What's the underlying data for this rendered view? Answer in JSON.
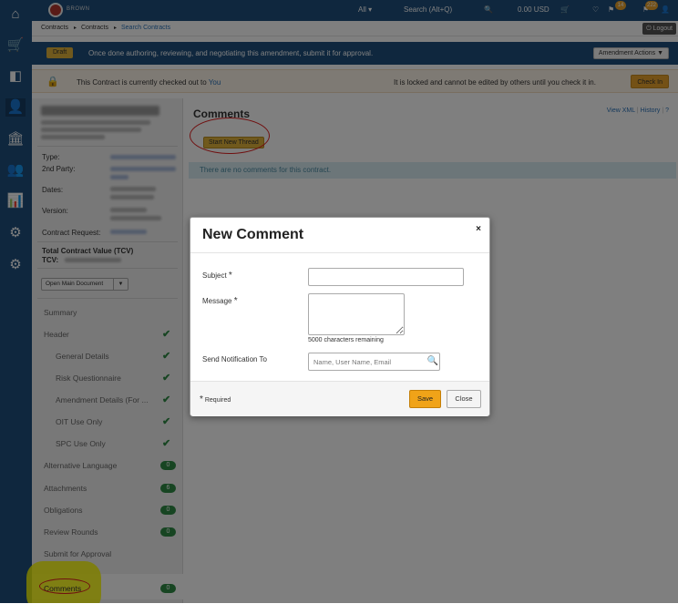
{
  "icons": {
    "home": "⌂",
    "cart": "🛒",
    "contracts": "◧",
    "user": "👤",
    "bank": "🏛",
    "group": "👥",
    "chart": "📊",
    "settings_user": "⚙",
    "gear": "⚙",
    "lock": "🔒",
    "search": "🔍",
    "close": "×",
    "caret": "▼",
    "chevron": "▸"
  },
  "header": {
    "logo_text": "BROWN",
    "all_label": "All ▾",
    "search_label": "Search (Alt+Q)",
    "balance": "0.00 USD",
    "notifications_count": "14",
    "user_count": "222",
    "logout_label": "⏻ Logout"
  },
  "breadcrumbs": {
    "items": [
      "Contracts",
      "Contracts",
      "Search Contracts"
    ]
  },
  "draft_banner": {
    "status": "Draft",
    "message": "Once done authoring, reviewing, and negotiating this amendment, submit it for approval.",
    "actions_label": "Amendment Actions"
  },
  "checkout_banner": {
    "message_prefix": "This Contract is currently checked out to",
    "user": "You",
    "locked_message": "It is locked and cannot be edited by others until you check it in.",
    "checkin_label": "Check In"
  },
  "sidebar": {
    "meta": {
      "type_label": "Type:",
      "party_label": "2nd Party:",
      "dates_label": "Dates:",
      "version_label": "Version:",
      "request_label": "Contract Request:",
      "tcv_label": "Total Contract Value (TCV)",
      "tcv_short": "TCV:"
    },
    "open_doc_label": "Open Main Document",
    "nav": [
      {
        "label": "Summary"
      },
      {
        "label": "Header"
      },
      {
        "label": "General Details"
      },
      {
        "label": "Risk Questionnaire"
      },
      {
        "label": "Amendment Details (For ..."
      },
      {
        "label": "OIT Use Only"
      },
      {
        "label": "SPC Use Only"
      },
      {
        "label": "Alternative Language",
        "count": "0"
      },
      {
        "label": "Attachments",
        "count": "6"
      },
      {
        "label": "Obligations",
        "count": "0"
      },
      {
        "label": "Review Rounds",
        "count": "0"
      },
      {
        "label": "Submit for Approval"
      },
      {
        "label": "Comments",
        "count": "0"
      }
    ]
  },
  "main": {
    "title": "Comments",
    "view_xml": "View XML",
    "history": "History",
    "help": "?",
    "start_thread": "Start New Thread",
    "empty_message": "There are no comments for this contract."
  },
  "modal": {
    "title": "New Comment",
    "subject_label": "Subject",
    "message_label": "Message",
    "chars_remaining": "5000 characters remaining",
    "notify_label": "Send Notification To",
    "notify_placeholder": "Name, User Name, Email",
    "required_note": "Required",
    "save_label": "Save",
    "close_label": "Close",
    "required_star": "*"
  }
}
